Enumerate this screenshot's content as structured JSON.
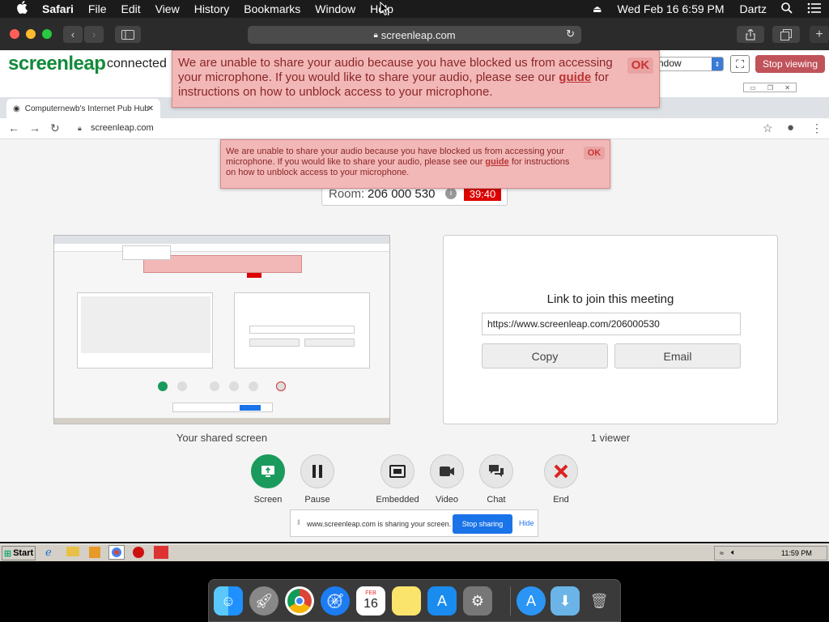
{
  "menubar": {
    "apple": "",
    "app": "Safari",
    "items": [
      "File",
      "Edit",
      "View",
      "History",
      "Bookmarks",
      "Window",
      "Help"
    ],
    "clock": "Wed Feb 16  6:59 PM",
    "user": "Dartz"
  },
  "safari": {
    "url": "screenleap.com"
  },
  "screenleap": {
    "logo": "screenleap",
    "status": "connected",
    "select_value": "ndow",
    "stop_viewing": "Stop viewing"
  },
  "error_top": {
    "text_before": "We are unable to share your audio because you have blocked us from accessing your microphone. If you would like to share your audio, please see our ",
    "link": "guide",
    "text_after": " for instructions on how to unblock access to your microphone.",
    "ok": "OK"
  },
  "chrome": {
    "tab1": "Computernewb's Internet Pub Hub",
    "url": "screenleap.com"
  },
  "error_inner": {
    "text_before": "We are unable to share your audio because you have blocked us from accessing your microphone. If you would like to share your audio, please see our ",
    "link": "guide",
    "text_after": " for instructions on how to unblock access to your microphone.",
    "ok": "OK"
  },
  "room": {
    "label": "Room:",
    "number": "206 000 530",
    "timer": "39:40"
  },
  "link_panel": {
    "title": "Link to join this meeting",
    "url": "https://www.screenleap.com/206000530",
    "copy": "Copy",
    "email": "Email"
  },
  "captions": {
    "shared": "Your shared screen",
    "viewers": "1 viewer"
  },
  "controls": [
    {
      "label": "Screen",
      "icon": "screen-share-icon"
    },
    {
      "label": "Pause",
      "icon": "pause-icon"
    },
    {
      "label": "Embedded",
      "icon": "embedded-icon"
    },
    {
      "label": "Video",
      "icon": "video-camera-icon"
    },
    {
      "label": "Chat",
      "icon": "chat-icon"
    },
    {
      "label": "End",
      "icon": "end-x-icon"
    }
  ],
  "share_bar": {
    "text": "www.screenleap.com is sharing your screen.",
    "stop": "Stop sharing",
    "hide": "Hide"
  },
  "taskbar": {
    "start": "Start",
    "clock": "11:59 PM"
  },
  "dock": {
    "calendar_month": "FEB",
    "calendar_day": "16"
  }
}
